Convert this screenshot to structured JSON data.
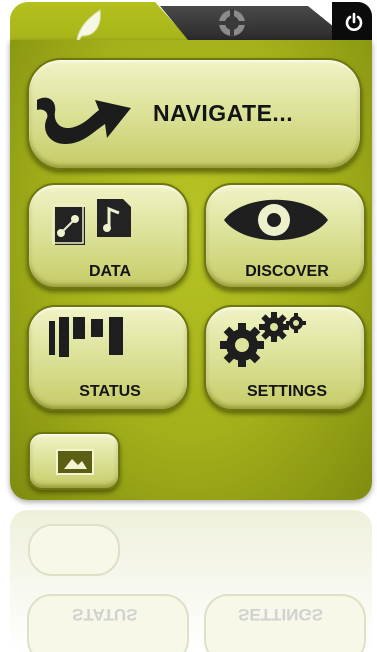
{
  "tabs": {
    "main_tab_icon": "leaf-icon",
    "second_tab_icon": "tyre-icon",
    "power_icon": "power-icon"
  },
  "menu": {
    "navigate_label": "NAVIGATE...",
    "data_label": "DATA",
    "discover_label": "DISCOVER",
    "status_label": "STATUS",
    "settings_label": "SETTINGS"
  },
  "reflection": {
    "status_label": "STATUS",
    "settings_label": "SETTINGS"
  },
  "colors": {
    "panel": "#a6b41a",
    "button": "#dde39b",
    "button_border": "#6f770b",
    "text": "#141414"
  }
}
